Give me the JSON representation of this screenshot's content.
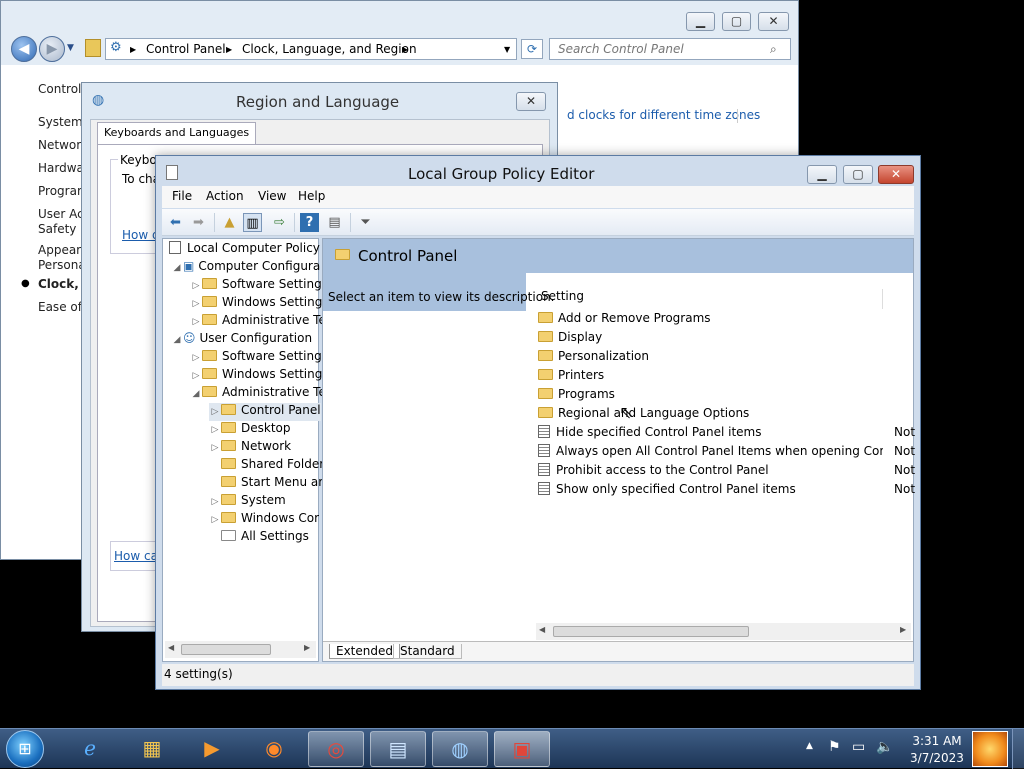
{
  "control_panel": {
    "address": {
      "segments": [
        "Control Panel",
        "Clock, Language, and Region"
      ]
    },
    "search_placeholder": "Search Control Panel",
    "nav": [
      "Control",
      "System a",
      "Network",
      "Hardwa",
      "Program",
      "User Acc",
      "Safety",
      "Appeara",
      "Personal",
      "Clock, L",
      "Ease of A"
    ],
    "link_text": "d clocks for different time zones"
  },
  "region_dialog": {
    "title": "Region and Language",
    "tab": "Keyboards and Languages",
    "group_title": "Keyboa",
    "group_text": "To cha",
    "link1": "How d",
    "link2": "How ca"
  },
  "gpe": {
    "title": "Local Group Policy Editor",
    "menus": [
      "File",
      "Action",
      "View",
      "Help"
    ],
    "tree": [
      {
        "label": "Local Computer Policy"
      },
      {
        "label": "Computer Configura"
      },
      {
        "label": "Software Settings"
      },
      {
        "label": "Windows Setting"
      },
      {
        "label": "Administrative Te"
      },
      {
        "label": "User Configuration"
      },
      {
        "label": "Software Settings"
      },
      {
        "label": "Windows Setting"
      },
      {
        "label": "Administrative Te"
      },
      {
        "label": "Control Panel"
      },
      {
        "label": "Desktop"
      },
      {
        "label": "Network"
      },
      {
        "label": "Shared Folder"
      },
      {
        "label": "Start Menu ar"
      },
      {
        "label": "System"
      },
      {
        "label": "Windows Cor"
      },
      {
        "label": "All Settings"
      }
    ],
    "panel_title": "Control Panel",
    "description": "Select an item to view its description.",
    "column_setting": "Setting",
    "settings": [
      {
        "label": "Add or Remove Programs",
        "type": "folder",
        "state": ""
      },
      {
        "label": "Display",
        "type": "folder",
        "state": ""
      },
      {
        "label": "Personalization",
        "type": "folder",
        "state": ""
      },
      {
        "label": "Printers",
        "type": "folder",
        "state": ""
      },
      {
        "label": "Programs",
        "type": "folder",
        "state": ""
      },
      {
        "label": "Regional and Language Options",
        "type": "folder",
        "state": ""
      },
      {
        "label": "Hide specified Control Panel items",
        "type": "policy",
        "state": "Not"
      },
      {
        "label": "Always open All Control Panel Items when opening Control ...",
        "type": "policy",
        "state": "Not"
      },
      {
        "label": "Prohibit access to the Control Panel",
        "type": "policy",
        "state": "Not"
      },
      {
        "label": "Show only specified Control Panel items",
        "type": "policy",
        "state": "Not"
      }
    ],
    "tabs": [
      "Extended",
      "Standard"
    ],
    "status": "4 setting(s)"
  },
  "taskbar": {
    "time": "3:31 AM",
    "date": "3/7/2023"
  },
  "icons": [
    "start-orb-icon",
    "ie-icon",
    "explorer-icon",
    "media-player-icon",
    "firefox-icon",
    "chrome-icon",
    "control-panel-icon",
    "region-globe-icon",
    "toolbox-icon"
  ]
}
